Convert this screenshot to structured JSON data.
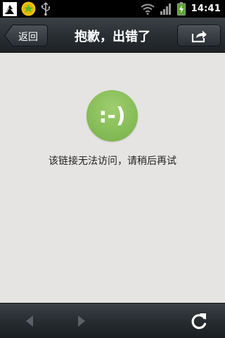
{
  "statusbar": {
    "time": "14:41",
    "icons": [
      "usb-debug-icon",
      "app-notification-icon",
      "usb-icon",
      "wifi-icon",
      "signal-icon",
      "battery-charging-icon"
    ]
  },
  "header": {
    "back_label": "返回",
    "title": "抱歉，出错了",
    "share_icon": "share-icon"
  },
  "main": {
    "smiley_text": ":-)",
    "message": "该链接无法访问，请稍后再试"
  },
  "toolbar": {
    "back_icon": "arrow-left-icon",
    "forward_icon": "arrow-right-icon",
    "refresh_icon": "refresh-icon"
  },
  "colors": {
    "smiley_green": "#86bd57",
    "background": "#e5e4e2",
    "bar_dark": "#2a2f33"
  }
}
